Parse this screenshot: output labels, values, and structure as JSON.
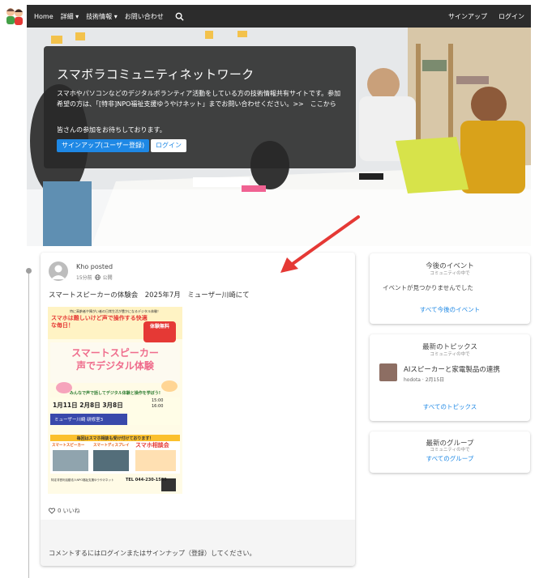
{
  "nav": {
    "home": "Home",
    "about": "詳細",
    "tech_info": "技術情報",
    "contact": "お問い合わせ",
    "signup": "サインアップ",
    "login": "ログイン"
  },
  "hero": {
    "title": "スマボラコミュニティネットワーク",
    "description": "スマホやパソコンなどのデジタルボランティア活動をしている方の技術情報共有サイトです。参加希望の方は、「[特非]NPO福祉支援ゆうやけネット」までお問い合わせください。>>　ここから",
    "note": "皆さんの参加をお待ちしております。",
    "signup_button": "サインアップ(ユーザー登録)",
    "login_button": "ログイン"
  },
  "post": {
    "author": "Kho posted",
    "time": "15分前",
    "visibility": "公開",
    "title": "スマートスピーカーの体験会　2025年7月　ミューザー川崎にて",
    "flyer": {
      "headline_small": "特に高齢者や障がい者の日常生活が豊かになるデジタル体験！",
      "headline": "スマホは難しいけど声で操作する快適な毎日！",
      "badge": "体験無料",
      "main1": "スマートスピーカー",
      "main2": "声でデジタル体験",
      "sub": "みんなで声で話してデジタル体験と操作を学ぼう!",
      "dates": "1月11日 2月8日 3月8日",
      "time_start": "15:00",
      "time_end": "16:00",
      "venue": "ミューザー川崎 研修室3",
      "banner": "毎回はスマホ相談も受け付けております！",
      "col1": "スマートスピーカー",
      "col2": "スマートディスプレイ",
      "col3": "スマホ相談会",
      "phone": "TEL 044-230-1589",
      "org": "特定非営利活動法人NPO福祉支援ゆうやけネット"
    },
    "likes": "0 いいね",
    "comment_note": "コメントするにはログインまたはサインナップ（登録）してください。"
  },
  "sidebar": {
    "events": {
      "title": "今後のイベント",
      "subtitle": "コミュニティの中で",
      "empty": "イベントが見つかりませんでした",
      "link": "すべて今後のイベント"
    },
    "topics": {
      "title": "最新のトピックス",
      "subtitle": "コミュニティの中で",
      "item_title": "AIスピーカーと家電製品の連携",
      "item_meta": "hodota · 2月15日",
      "link": "すべてのトピックス"
    },
    "groups": {
      "title": "最新のグループ",
      "subtitle": "コミュニティの中で",
      "link": "すべてのグループ"
    }
  },
  "colors": {
    "accent": "#1e88e5",
    "nav_bg": "#2c2c2c",
    "arrow": "#e53935"
  }
}
